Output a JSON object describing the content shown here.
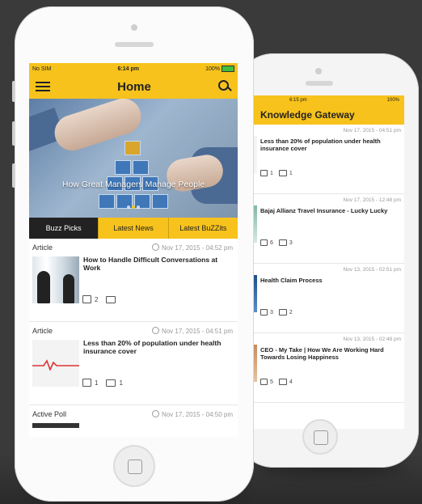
{
  "colors": {
    "accent": "#f7c21b",
    "dark": "#222222",
    "background": "#3a3a3a"
  },
  "front": {
    "status": {
      "carrier": "No SIM",
      "time": "6:14 pm",
      "battery": "100%"
    },
    "header": {
      "title": "Home",
      "menu_icon": "hamburger-icon",
      "search_icon": "search-icon"
    },
    "hero": {
      "caption": "How Great Managers Manage People",
      "slides": 3,
      "active_slide": 2
    },
    "tabs": [
      {
        "label": "Buzz Picks",
        "active": true
      },
      {
        "label": "Latest News",
        "active": false
      },
      {
        "label": "Latest BuZZits",
        "active": false
      }
    ],
    "feed": [
      {
        "category": "Article",
        "date": "Nov 17, 2015 - 04:52 pm",
        "title": "How to Handle Difficult Conversations at Work",
        "likes": "2",
        "comments": ""
      },
      {
        "category": "Article",
        "date": "Nov 17, 2015 - 04:51 pm",
        "title": "Less than 20% of population under health insurance cover",
        "likes": "1",
        "comments": "1"
      },
      {
        "category": "Active Poll",
        "date": "Nov 17, 2015 - 04:50 pm"
      }
    ]
  },
  "back": {
    "status": {
      "time": "6:15 pm",
      "battery": "100%"
    },
    "header": {
      "title": "Knowledge Gateway"
    },
    "feed": [
      {
        "date": "Nov 17, 2015 - 04:51 pm",
        "title": "Less than 20% of population under health insurance cover",
        "likes": "1",
        "comments": "1"
      },
      {
        "date": "Nov 17, 2015 - 12:48 pm",
        "title": "Bajaj Allianz Travel Insurance - Lucky Lucky",
        "likes": "6",
        "comments": "3"
      },
      {
        "date": "Nov 13, 2015 - 02:51 pm",
        "title": "Health Claim Process",
        "likes": "3",
        "comments": "2"
      },
      {
        "date": "Nov 13, 2015 - 02:48 pm",
        "title": "CEO - My Take | How We Are Working Hard Towards Losing Happiness",
        "likes": "5",
        "comments": "4"
      }
    ]
  }
}
